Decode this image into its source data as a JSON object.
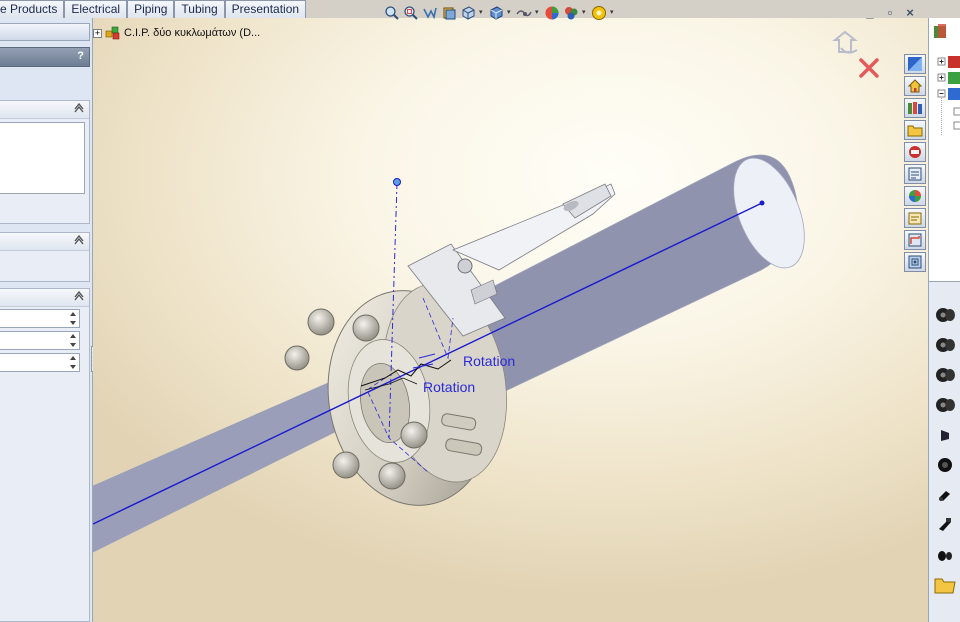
{
  "tabs": [
    "e Products",
    "Electrical",
    "Piping",
    "Tubing",
    "Presentation"
  ],
  "left_panel": {
    "help_label": "?"
  },
  "tree": {
    "root_label": "C.I.P. δύο κυκλωμάτων  (D..."
  },
  "viewport": {
    "annotations": {
      "rotation_upper": "Rotation",
      "rotation_lower": "Rotation"
    }
  },
  "hud": {
    "icons": [
      "zoom-to-fit-icon",
      "zoom-area-icon",
      "previous-view-icon",
      "section-view-icon",
      "view-orientation-icon",
      "display-style-icon",
      "hide-show-icon",
      "edit-appearance-icon",
      "apply-scene-icon",
      "view-settings-icon"
    ]
  },
  "window_controls": [
    "_",
    "▫",
    "×"
  ],
  "task_pane": {
    "icons": [
      "view-palette-icon",
      "home-icon",
      "design-library-icon",
      "file-explorer-icon",
      "toolbox-icon",
      "view-properties-icon",
      "appearances-icon",
      "custom-properties-icon",
      "routing-library-icon",
      "task-scheduler-icon"
    ]
  },
  "colors": {
    "accent_blue": "#1a1ad0",
    "panel_bg": "#dde6f2",
    "cancel_red": "#e45a5a"
  }
}
